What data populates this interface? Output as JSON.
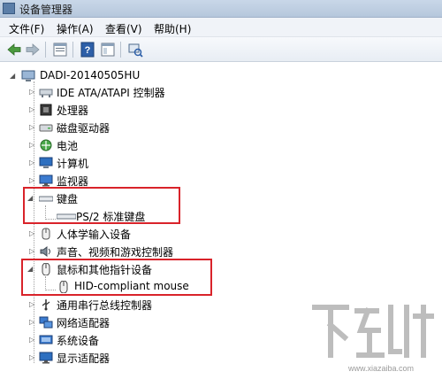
{
  "window": {
    "title": "设备管理器"
  },
  "menu": [
    {
      "label": "文件(F)"
    },
    {
      "label": "操作(A)"
    },
    {
      "label": "查看(V)"
    },
    {
      "label": "帮助(H)"
    }
  ],
  "toolbar": {
    "buttons": [
      {
        "icon": "back-arrow-icon"
      },
      {
        "icon": "forward-arrow-icon"
      },
      {
        "icon": "properties-icon"
      },
      {
        "icon": "help-icon"
      },
      {
        "icon": "console-icon"
      },
      {
        "icon": "scan-hardware-icon"
      }
    ]
  },
  "tree": {
    "root": {
      "label": "DADI-20140505HU",
      "icon": "computer-icon"
    },
    "categories": [
      {
        "label": "IDE ATA/ATAPI 控制器",
        "icon": "ide-controller-icon",
        "expanded": false
      },
      {
        "label": "处理器",
        "icon": "processor-icon",
        "expanded": false
      },
      {
        "label": "磁盘驱动器",
        "icon": "disk-drive-icon",
        "expanded": false
      },
      {
        "label": "电池",
        "icon": "battery-icon",
        "expanded": false
      },
      {
        "label": "计算机",
        "icon": "computer-icon",
        "expanded": false
      },
      {
        "label": "监视器",
        "icon": "monitor-icon",
        "expanded": false
      },
      {
        "label": "键盘",
        "icon": "keyboard-icon",
        "expanded": true,
        "children": [
          {
            "label": "PS/2 标准键盘",
            "icon": "keyboard-icon"
          }
        ]
      },
      {
        "label": "人体学输入设备",
        "icon": "hid-icon",
        "expanded": false
      },
      {
        "label": "声音、视频和游戏控制器",
        "icon": "speaker-icon",
        "expanded": false
      },
      {
        "label": "鼠标和其他指针设备",
        "icon": "mouse-icon",
        "expanded": true,
        "children": [
          {
            "label": "HID-compliant mouse",
            "icon": "mouse-icon"
          }
        ]
      },
      {
        "label": "通用串行总线控制器",
        "icon": "usb-icon",
        "expanded": false
      },
      {
        "label": "网络适配器",
        "icon": "network-adapter-icon",
        "expanded": false
      },
      {
        "label": "系统设备",
        "icon": "system-device-icon",
        "expanded": false
      },
      {
        "label": "显示适配器",
        "icon": "display-adapter-icon",
        "expanded": false
      }
    ]
  },
  "colors": {
    "highlight_box": "#d9232a"
  },
  "watermark": {
    "text": "下载吧",
    "url": "www.xiazaiba.com"
  }
}
